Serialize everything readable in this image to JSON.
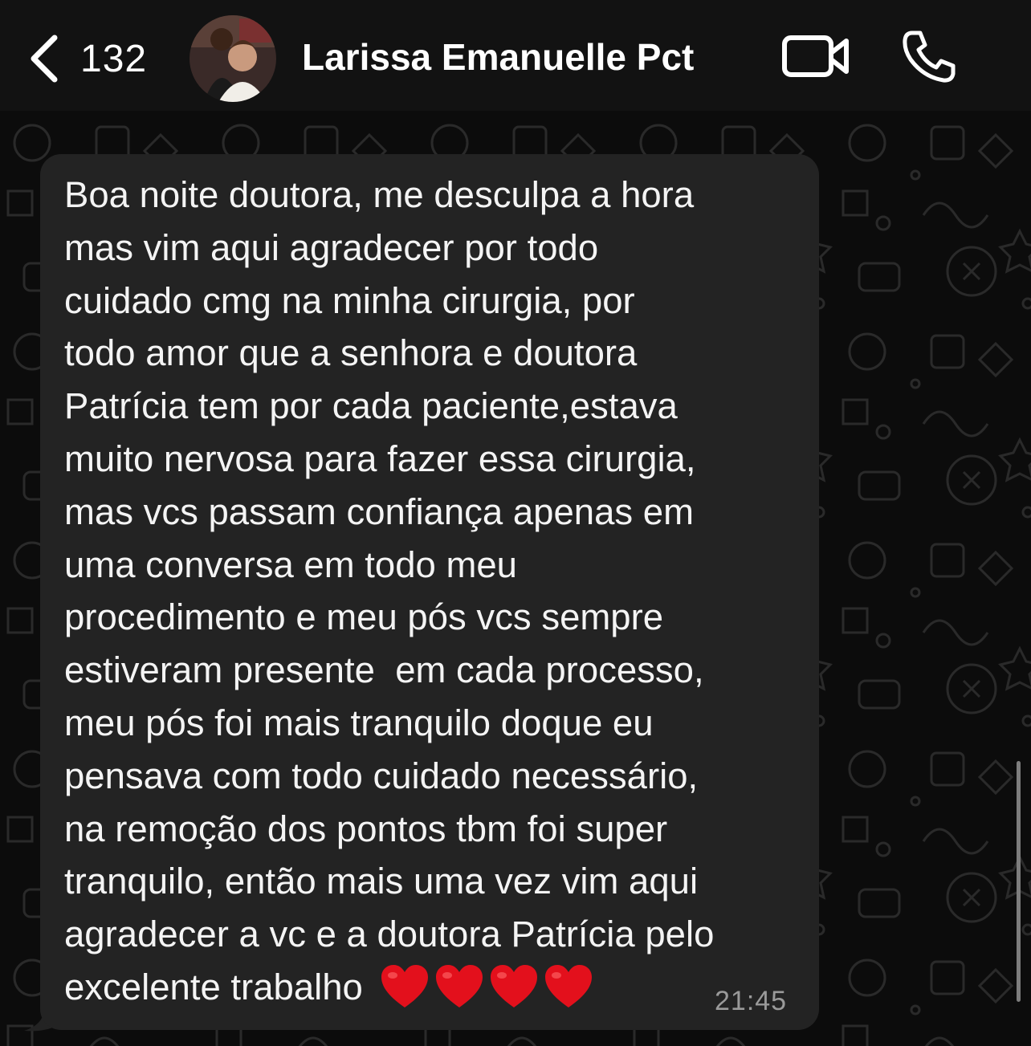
{
  "header": {
    "back_icon": "chevron-left-icon",
    "unread_count": "132",
    "contact_name": "Larissa Emanuelle Pct",
    "video_icon": "video-camera-icon",
    "call_icon": "phone-icon"
  },
  "message": {
    "lines": [
      "Boa noite doutora, me desculpa a hora",
      "mas vim aqui agradecer por todo",
      "cuidado cmg na minha cirurgia, por",
      "todo amor que a senhora e doutora",
      "Patrícia tem por cada paciente,estava",
      "muito nervosa para fazer essa cirurgia,",
      "mas vcs passam confiança apenas em",
      "uma conversa em todo meu",
      "procedimento e meu pós vcs sempre",
      "estiveram presente  em cada processo,",
      "meu pós foi mais tranquilo doque eu",
      "pensava com todo cuidado necessário,",
      "na remoção dos pontos tbm foi super",
      "tranquilo, então mais uma vez vim aqui",
      "agradecer a vc e a doutora Patrícia pelo",
      "excelente trabalho"
    ],
    "emoji_icons": [
      "red-heart-icon",
      "red-heart-icon",
      "red-heart-icon",
      "red-heart-icon"
    ],
    "time": "21:45"
  },
  "colors": {
    "header_bg": "#121212",
    "wallpaper_bg": "#0c0c0c",
    "bubble_bg": "#232323",
    "text": "#f4f4f4",
    "time_text": "#9a9a9a",
    "heart": "#e3101c"
  }
}
